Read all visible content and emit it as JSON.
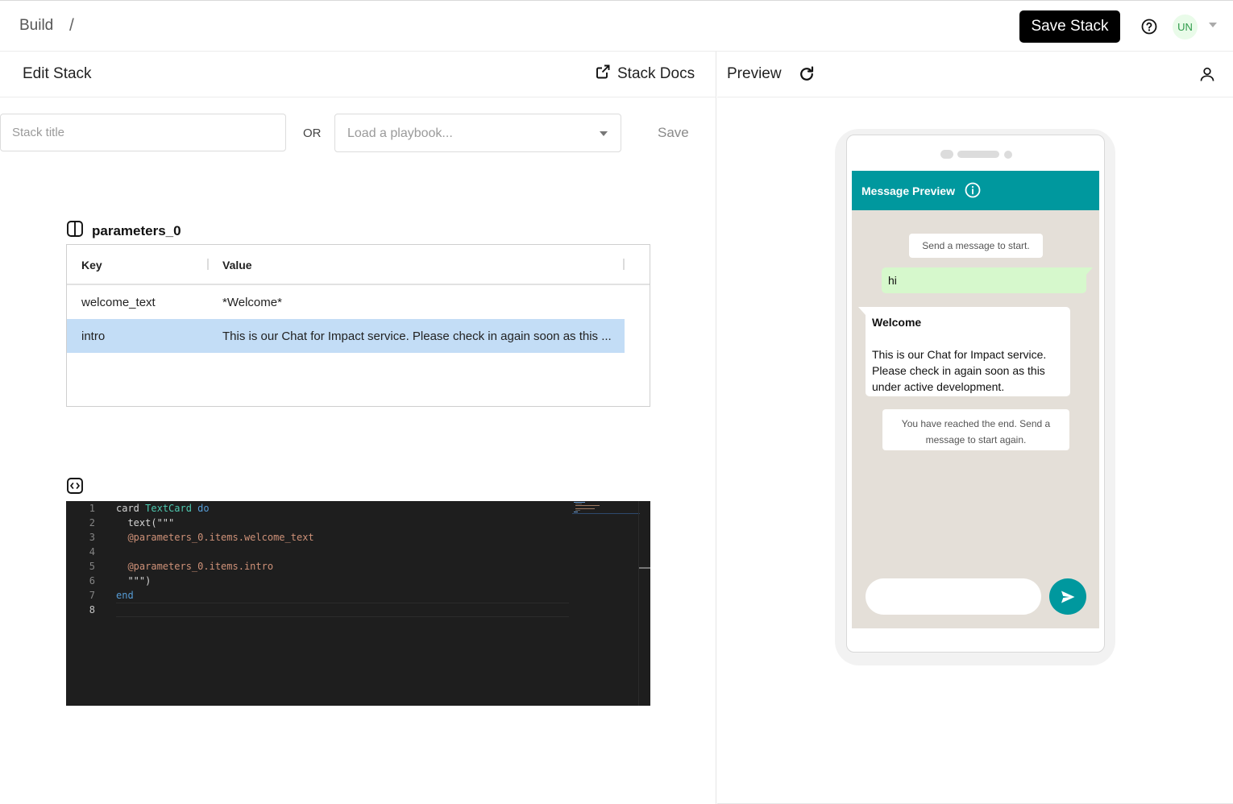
{
  "topbar": {
    "breadcrumb": "Build",
    "separator": "/",
    "save_stack_label": "Save Stack",
    "avatar_initials": "UN"
  },
  "editor_panel": {
    "title": "Edit Stack",
    "docs_label": "Stack Docs",
    "stack_title_placeholder": "Stack title",
    "or_label": "OR",
    "playbook_placeholder": "Load a playbook...",
    "save_label": "Save"
  },
  "parameters": {
    "title": "parameters_0",
    "columns": [
      "Key",
      "Value"
    ],
    "rows": [
      {
        "key": "welcome_text",
        "value": "*Welcome*"
      },
      {
        "key": "intro",
        "value": "This is our Chat for Impact service. Please check in again soon as this ..."
      }
    ]
  },
  "code": {
    "line_numbers": [
      "1",
      "2",
      "3",
      "4",
      "5",
      "6",
      "7",
      "8"
    ],
    "line1": {
      "kw1": "card",
      "type": "TextCard",
      "kw2": "do"
    },
    "line2": "  text(\"\"\"",
    "line3": "  @parameters_0.items.welcome_text",
    "line5": "  @parameters_0.items.intro",
    "line6": "  \"\"\")",
    "line7": "end"
  },
  "preview_panel": {
    "title": "Preview",
    "message_preview_title": "Message Preview",
    "system_start": "Send a message to start.",
    "outgoing": "hi",
    "incoming_title": "Welcome",
    "incoming_body": "This is our Chat for Impact service. Please check in again soon as this under active development.",
    "system_end": "You have reached the end. Send a message to start again.",
    "composer_value": ""
  },
  "colors": {
    "accent": "#00989e",
    "outgoing_bubble": "#d6f8cc",
    "selected_row": "#c3ddf6",
    "editor_bg": "#1e1e1e"
  }
}
